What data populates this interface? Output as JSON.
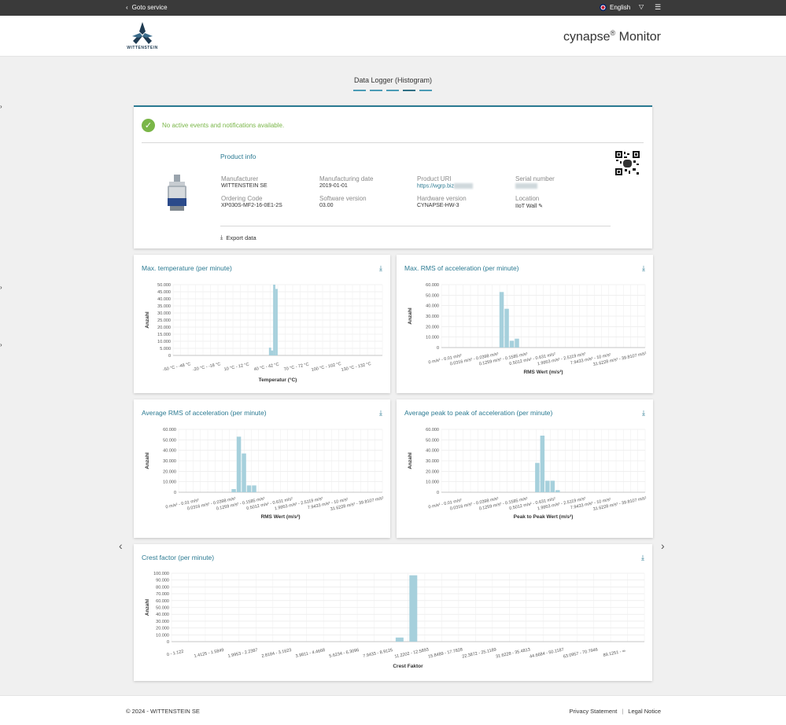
{
  "topbar": {
    "back_label": "Goto service",
    "language": "English"
  },
  "header": {
    "logo_text": "WITTENSTEIN",
    "brand_name": "cynapse",
    "brand_mark": "®",
    "brand_suffix": "Monitor"
  },
  "page": {
    "title": "Data Logger (Histogram)",
    "dots": 5,
    "active_dot": 3
  },
  "status": {
    "message": "No active events and notifications available."
  },
  "product": {
    "title": "Product info",
    "fields": [
      {
        "label": "Manufacturer",
        "value": "WITTENSTEIN SE"
      },
      {
        "label": "Manufacturing date",
        "value": "2019-01-01"
      },
      {
        "label": "Product URI",
        "value": "https://wgrp.biz"
      },
      {
        "label": "Serial number",
        "value": ""
      },
      {
        "label": "Ordering Code",
        "value": "XP030S-MF2-16-0E1-2S"
      },
      {
        "label": "Software version",
        "value": "03.00"
      },
      {
        "label": "Hardware version",
        "value": "CYNAPSE-HW-3"
      },
      {
        "label": "Location",
        "value": "IIoT Wall"
      }
    ],
    "export_label": "Export data"
  },
  "chart_data": [
    {
      "type": "bar",
      "title": "Max. temperature (per minute)",
      "xlabel": "Temperatur (°C)",
      "ylabel": "Anzahl",
      "ylim": [
        0,
        50000
      ],
      "yticks": [
        "0",
        "5.000",
        "10.000",
        "15.000",
        "20.000",
        "25.000",
        "30.000",
        "35.000",
        "40.000",
        "45.000",
        "50.000"
      ],
      "xtick_labels": [
        "-50 °C - -48 °C",
        "-20 °C - -18 °C",
        "10 °C - 12 °C",
        "40 °C - 42 °C",
        "70 °C - 72 °C",
        "100 °C - 102 °C",
        "130 °C - 132 °C"
      ],
      "bars": [
        {
          "pos": 0.458,
          "value": 5500
        },
        {
          "pos": 0.468,
          "value": 3500
        },
        {
          "pos": 0.478,
          "value": 50000
        },
        {
          "pos": 0.489,
          "value": 47000
        }
      ]
    },
    {
      "type": "bar",
      "title": "Max. RMS of acceleration (per minute)",
      "xlabel": "RMS Wert (m/s²)",
      "ylabel": "Anzahl",
      "ylim": [
        0,
        60000
      ],
      "yticks": [
        "0",
        "10.000",
        "20.000",
        "30.000",
        "40.000",
        "50.000",
        "60.000"
      ],
      "xtick_labels": [
        "0 m/s² - 0.01 m/s²",
        "0.0316 m/s² - 0.0398 m/s²",
        "0.1259 m/s² - 0.1585 m/s²",
        "0.5012 m/s² - 0.631 m/s²",
        "1.9953 m/s² - 2.5119 m/s²",
        "7.9433 m/s² - 10 m/s²",
        "31.6228 m/s² - 39.8107 m/s²"
      ],
      "bars": [
        {
          "pos": 0.285,
          "value": 53000
        },
        {
          "pos": 0.31,
          "value": 37000
        },
        {
          "pos": 0.335,
          "value": 6500
        },
        {
          "pos": 0.36,
          "value": 8500
        }
      ]
    },
    {
      "type": "bar",
      "title": "Average RMS of acceleration (per minute)",
      "xlabel": "RMS Wert (m/s²)",
      "ylabel": "Anzahl",
      "ylim": [
        0,
        60000
      ],
      "yticks": [
        "0",
        "10.000",
        "20.000",
        "30.000",
        "40.000",
        "50.000",
        "60.000"
      ],
      "xtick_labels": [
        "0 m/s² - 0.01 m/s²",
        "0.0316 m/s² - 0.0398 m/s²",
        "0.1259 m/s² - 0.1585 m/s²",
        "0.5012 m/s² - 0.631 m/s²",
        "1.9953 m/s² - 2.5119 m/s²",
        "7.9433 m/s² - 10 m/s²",
        "31.6228 m/s² - 39.8107 m/s²"
      ],
      "bars": [
        {
          "pos": 0.26,
          "value": 3000
        },
        {
          "pos": 0.285,
          "value": 53000
        },
        {
          "pos": 0.31,
          "value": 37000
        },
        {
          "pos": 0.335,
          "value": 6500
        },
        {
          "pos": 0.36,
          "value": 6500
        }
      ]
    },
    {
      "type": "bar",
      "title": "Average peak to peak of acceleration (per minute)",
      "xlabel": "Peak to Peak Wert (m/s²)",
      "ylabel": "Anzahl",
      "ylim": [
        0,
        60000
      ],
      "yticks": [
        "0",
        "10.000",
        "20.000",
        "30.000",
        "40.000",
        "50.000",
        "60.000"
      ],
      "xtick_labels": [
        "0 m/s² - 0.01 m/s²",
        "0.0316 m/s² - 0.0398 m/s²",
        "0.1259 m/s² - 0.1585 m/s²",
        "0.5012 m/s² - 0.631 m/s²",
        "1.9953 m/s² - 2.5119 m/s²",
        "7.9433 m/s² - 10 m/s²",
        "31.6228 m/s² - 39.8107 m/s²"
      ],
      "bars": [
        {
          "pos": 0.46,
          "value": 28000
        },
        {
          "pos": 0.485,
          "value": 54000
        },
        {
          "pos": 0.51,
          "value": 11000
        },
        {
          "pos": 0.535,
          "value": 11000
        },
        {
          "pos": 0.56,
          "value": 2000
        }
      ]
    },
    {
      "type": "bar",
      "title": "Crest factor (per minute)",
      "xlabel": "Crest Faktor",
      "ylabel": "Anzahl",
      "ylim": [
        0,
        100000
      ],
      "yticks": [
        "0",
        "10.000",
        "20.000",
        "30.000",
        "40.000",
        "50.000",
        "60.000",
        "70.000",
        "80.000",
        "90.000",
        "100.000"
      ],
      "xtick_labels": [
        "0 - 1.122",
        "1.4125 - 1.5849",
        "1.9953 - 2.2387",
        "2.8184 - 3.1623",
        "3.9811 - 4.4668",
        "5.6234 - 6.3096",
        "7.9433 - 8.9125",
        "11.2202 - 12.5893",
        "15.8489 - 17.7828",
        "22.3872 - 25.1189",
        "31.6228 - 35.4813",
        "44.6684 - 50.1187",
        "63.0957 - 70.7946",
        "89.1251 - ∞"
      ],
      "bars": [
        {
          "pos": 0.474,
          "value": 6000
        },
        {
          "pos": 0.503,
          "value": 97000
        }
      ]
    }
  ],
  "footer": {
    "copyright": "© 2024 - WITTENSTEIN SE",
    "privacy": "Privacy Statement",
    "legal": "Legal Notice"
  }
}
